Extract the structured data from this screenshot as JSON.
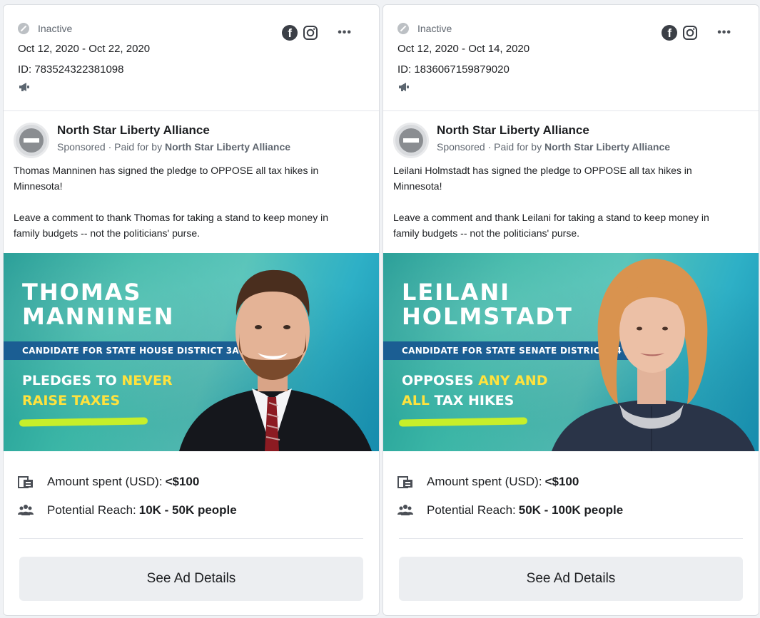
{
  "cards": [
    {
      "status": "Inactive",
      "dates": "Oct 12, 2020 - Oct 22, 2020",
      "ad_id": "ID: 783524322381098",
      "page_name": "North Star Liberty Alliance",
      "sponsored_prefix": "Sponsored · Paid for by ",
      "paid_by": "North Star Liberty Alliance",
      "ad_text": "Thomas Manninen has signed the pledge to OPPOSE all tax hikes in Minnesota!\n\nLeave a comment to thank Thomas for taking a stand to keep money in family budgets -- not the politicians' purse.",
      "banner": {
        "name_line1": "THOMAS",
        "name_line2": "MANNINEN",
        "district": "CANDIDATE FOR STATE HOUSE DISTRICT 3A",
        "pledge_line1_a": "PLEDGES TO ",
        "pledge_line1_b": "NEVER",
        "pledge_line2_a": "",
        "pledge_line2_b": "RAISE TAXES"
      },
      "spent_label": "Amount spent (USD):",
      "spent_value": "<$100",
      "reach_label": "Potential Reach:",
      "reach_value": "10K - 50K people",
      "button_label": "See Ad Details"
    },
    {
      "status": "Inactive",
      "dates": "Oct 12, 2020 - Oct 14, 2020",
      "ad_id": "ID: 1836067159879020",
      "page_name": "North Star Liberty Alliance",
      "sponsored_prefix": "Sponsored · Paid for by ",
      "paid_by": "North Star Liberty Alliance",
      "ad_text": "Leilani Holmstadt has signed the pledge to OPPOSE all tax hikes in Minnesota!\n\nLeave a comment and thank Leilani for taking a stand to keep money in family budgets -- not the politicians' purse.",
      "banner": {
        "name_line1": "LEILANI",
        "name_line2": "HOLMSTADT",
        "district": "CANDIDATE FOR STATE SENATE DISTRICT 54",
        "pledge_line1_a": "OPPOSES ",
        "pledge_line1_b": "ANY AND",
        "pledge_line2_a": "ALL",
        "pledge_line2_b": " TAX HIKES"
      },
      "spent_label": "Amount spent (USD):",
      "spent_value": "<$100",
      "reach_label": "Potential Reach:",
      "reach_value": "50K - 100K people",
      "button_label": "See Ad Details"
    }
  ],
  "icons": {
    "status": "inactive-icon",
    "platform_1": "facebook-icon",
    "platform_2": "instagram-icon",
    "more": "more-options-icon",
    "ad_type": "megaphone-icon",
    "spent": "money-icon",
    "reach": "people-icon"
  },
  "colors": {
    "button_bg": "#eceef1",
    "banner_teal": "#3db8a8",
    "district_bar": "#1b5e93",
    "highlight_yellow": "#ffe23d",
    "swoosh_green": "#c7ef2a"
  }
}
